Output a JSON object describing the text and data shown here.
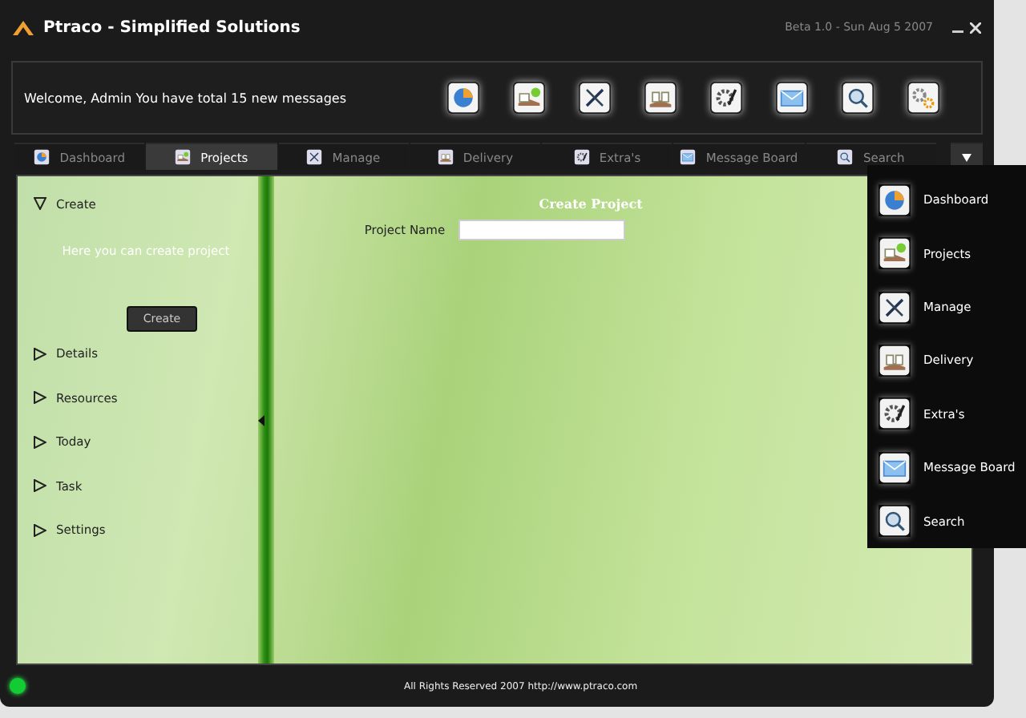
{
  "window": {
    "title": "Ptraco - Simplified Solutions",
    "version": "Beta 1.0 - Sun Aug 5 2007"
  },
  "header": {
    "welcome": "Welcome, Admin You have total 15 new messages"
  },
  "tabs": [
    {
      "label": "Dashboard",
      "selected": false
    },
    {
      "label": "Projects",
      "selected": true
    },
    {
      "label": "Manage",
      "selected": false
    },
    {
      "label": "Delivery",
      "selected": false
    },
    {
      "label": "Extra's",
      "selected": false
    },
    {
      "label": "Message Board",
      "selected": false
    },
    {
      "label": "Search",
      "selected": false
    }
  ],
  "sidebar": {
    "items": [
      {
        "label": "Create",
        "expanded": true,
        "description": "Here you can create project",
        "button": "Create"
      },
      {
        "label": "Details",
        "expanded": false
      },
      {
        "label": "Resources",
        "expanded": false
      },
      {
        "label": "Today",
        "expanded": false
      },
      {
        "label": "Task",
        "expanded": false
      },
      {
        "label": "Settings",
        "expanded": false
      }
    ]
  },
  "form": {
    "title": "Create Project",
    "fields": [
      {
        "label": "Project Name"
      }
    ]
  },
  "menu": {
    "items": [
      "Dashboard",
      "Projects",
      "Manage",
      "Delivery",
      "Extra's",
      "Message Board",
      "Search"
    ]
  },
  "status_bar": {
    "text": "All Rights Reserved 2007 http://www.ptraco.com"
  }
}
